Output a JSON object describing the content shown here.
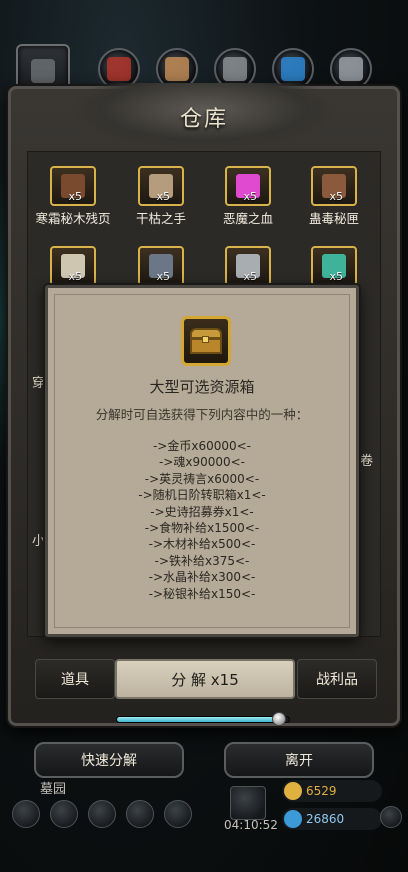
{
  "window": {
    "title": "仓库"
  },
  "top_tabs": [
    {
      "icon": "helmet-icon",
      "color": "#6a6e72"
    },
    {
      "icon": "red-armor-icon",
      "color": "#b2352c"
    },
    {
      "icon": "bracer-icon",
      "color": "#c28c57"
    },
    {
      "icon": "gauntlet-icon",
      "color": "#8a8e92"
    },
    {
      "icon": "blue-crystal-icon",
      "color": "#2c86d2"
    },
    {
      "icon": "chain-icon",
      "color": "#9aa0a4"
    }
  ],
  "inventory": {
    "row1": [
      {
        "name": "寒霜秘木残页",
        "qty": "x5",
        "color": "#7a4a2e"
      },
      {
        "name": "干枯之手",
        "qty": "x5",
        "color": "#b59c7c"
      },
      {
        "name": "恶魔之血",
        "qty": "x5",
        "color": "#e04ad0"
      },
      {
        "name": "蛊毒秘匣",
        "qty": "x5",
        "color": "#8b5a3c"
      }
    ],
    "row2": [
      {
        "qty": "x5",
        "color": "#cfc6b2"
      },
      {
        "qty": "x5",
        "color": "#6b7786"
      },
      {
        "qty": "x5",
        "color": "#a8adb2"
      },
      {
        "qty": "x5",
        "color": "#3fb39a"
      }
    ],
    "fragments": {
      "left_top": "穿",
      "right": "卷",
      "left_mid": "小"
    }
  },
  "bottom_tabs": {
    "items": "道具",
    "decompose": "分 解 x15",
    "loot": "战利品"
  },
  "progress": {
    "fraction": 0.94
  },
  "buttons": {
    "quick": "快速分解",
    "leave": "离开"
  },
  "hud": {
    "zone_label": "墓园",
    "timer": "04:10:52",
    "gold": "6529",
    "gems": "26860",
    "gold_color": "#e0b040",
    "gem_color": "#3d9ad8"
  },
  "dialog": {
    "title": "大型可选资源箱",
    "subtitle": "分解时可自选获得下列内容中的一种：",
    "options": [
      "->金币x60000<-",
      "->魂x90000<-",
      "->英灵祷言x6000<-",
      "->随机日阶转职箱x1<-",
      "->史诗招募券x1<-",
      "->食物补给x1500<-",
      "->木材补给x500<-",
      "->铁补给x375<-",
      "->水晶补给x300<-",
      "->秘银补给x150<-"
    ]
  }
}
